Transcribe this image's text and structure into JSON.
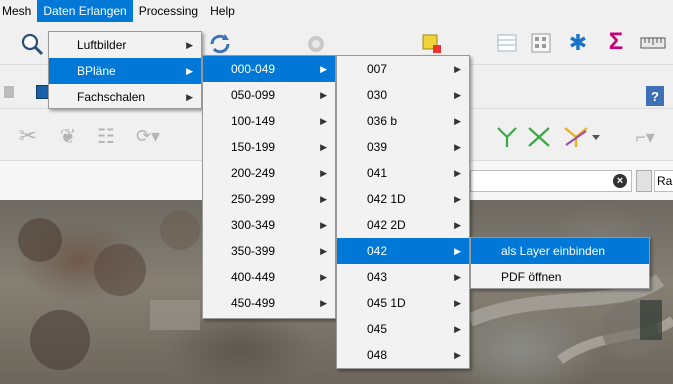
{
  "menubar": {
    "items": [
      "Mesh",
      "Daten Erlangen",
      "Processing",
      "Help"
    ],
    "active_index": 1
  },
  "search": {
    "value": "",
    "clear_icon": "clear-icon",
    "button_label": "Ra"
  },
  "toolbar_icons": {
    "help_label": "?",
    "sum_label": "Σ"
  },
  "menu_level1": {
    "items": [
      {
        "label": "Luftbilder",
        "has_submenu": true
      },
      {
        "label": "BPläne",
        "has_submenu": true,
        "highlighted": true
      },
      {
        "label": "Fachschalen",
        "has_submenu": true
      }
    ]
  },
  "menu_level2": {
    "items": [
      {
        "label": "000-049",
        "highlighted": true
      },
      {
        "label": "050-099"
      },
      {
        "label": "100-149"
      },
      {
        "label": "150-199"
      },
      {
        "label": "200-249"
      },
      {
        "label": "250-299"
      },
      {
        "label": "300-349"
      },
      {
        "label": "350-399"
      },
      {
        "label": "400-449"
      },
      {
        "label": "450-499"
      }
    ]
  },
  "menu_level3": {
    "items": [
      {
        "label": "007"
      },
      {
        "label": "030"
      },
      {
        "label": "036 b"
      },
      {
        "label": "039"
      },
      {
        "label": "041"
      },
      {
        "label": "042 1D"
      },
      {
        "label": "042 2D"
      },
      {
        "label": "042",
        "highlighted": true
      },
      {
        "label": "043"
      },
      {
        "label": "045 1D"
      },
      {
        "label": "045"
      },
      {
        "label": "048"
      }
    ]
  },
  "menu_level4": {
    "items": [
      {
        "label": "als Layer einbinden",
        "highlighted": true
      },
      {
        "label": "PDF öffnen"
      }
    ]
  },
  "colors": {
    "highlight": "#0078d7",
    "menu_bg": "#f2f2f2",
    "sum_icon": "#c8007a",
    "gear_icon": "#1a73c9"
  }
}
